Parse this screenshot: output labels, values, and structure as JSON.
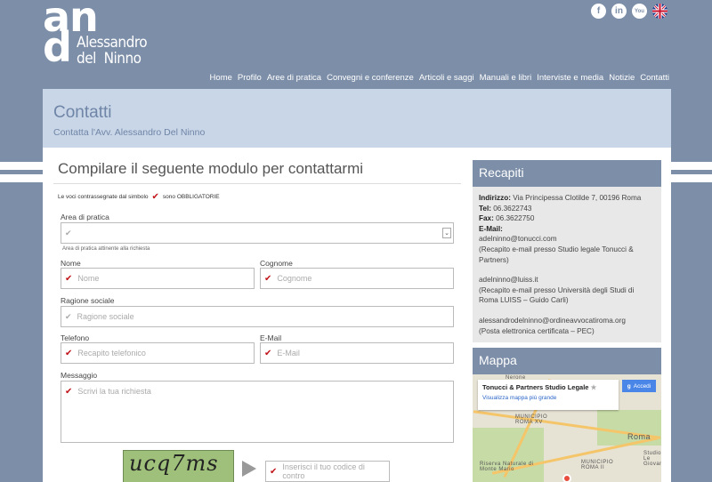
{
  "brand": {
    "monogram_top": "an",
    "monogram_bottom": "d",
    "name_line1": "Alessandro",
    "name_line2": "del  Ninno"
  },
  "social": [
    "f",
    "in",
    "You",
    "UK"
  ],
  "nav": [
    "Home",
    "Profilo",
    "Aree di pratica",
    "Convegni e conferenze",
    "Articoli e saggi",
    "Manuali e libri",
    "Interviste e media",
    "Notizie",
    "Contatti"
  ],
  "page": {
    "title": "Contatti",
    "subtitle": "Contatta l'Avv. Alessandro Del Ninno"
  },
  "form": {
    "heading": "Compilare il seguente modulo per contattarmi",
    "required_note_before": "Le voci contrassegnate dal simbolo",
    "required_note_after": "sono OBBLIGATORIE",
    "area_label": "Area di pratica",
    "area_hint": "Area di pratica attinente alla richiesta",
    "nome_label": "Nome",
    "nome_placeholder": "Nome",
    "cognome_label": "Cognome",
    "cognome_placeholder": "Cognome",
    "ragione_label": "Ragione sociale",
    "ragione_placeholder": "Ragione sociale",
    "telefono_label": "Telefono",
    "telefono_placeholder": "Recapito telefonico",
    "email_label": "E-Mail",
    "email_placeholder": "E-Mail",
    "messaggio_label": "Messaggio",
    "messaggio_placeholder": "Scrivi la tua richiesta",
    "captcha_text": "ucq7ms",
    "captcha_placeholder": "Inserisci il tuo codice di contro"
  },
  "recapiti": {
    "title": "Recapiti",
    "indirizzo_label": "Indirizzo:",
    "indirizzo": "Via Principessa Clotilde 7, 00196 Roma",
    "tel_label": "Tel:",
    "tel": "06.3622743",
    "fax_label": "Fax:",
    "fax": "06.3622750",
    "email_label": "E-Mail:",
    "email1": "adelninno@tonucci.com",
    "email1_note": "(Recapito e-mail presso Studio legale Tonucci & Partners)",
    "email2": "adelninno@luiss.it",
    "email2_note": "(Recapito e-mail presso Università degli Studi di Roma LUISS – Guido Carli)",
    "email3": "alessandrodelninno@ordineavvocatiroma.org",
    "email3_note": "(Posta elettronica certificata – PEC)"
  },
  "mappa": {
    "title": "Mappa",
    "place": "Tonucci & Partners Studio Legale",
    "link": "Visualizza mappa più grande",
    "accedi": "Accedi",
    "labels": [
      "Nerone",
      "MUNICIPIO ROMA XV",
      "MUNICIPIO ROMA II",
      "Riserva Naturale di Monte Mario",
      "Roma",
      "Studio Le Giovanni"
    ]
  }
}
